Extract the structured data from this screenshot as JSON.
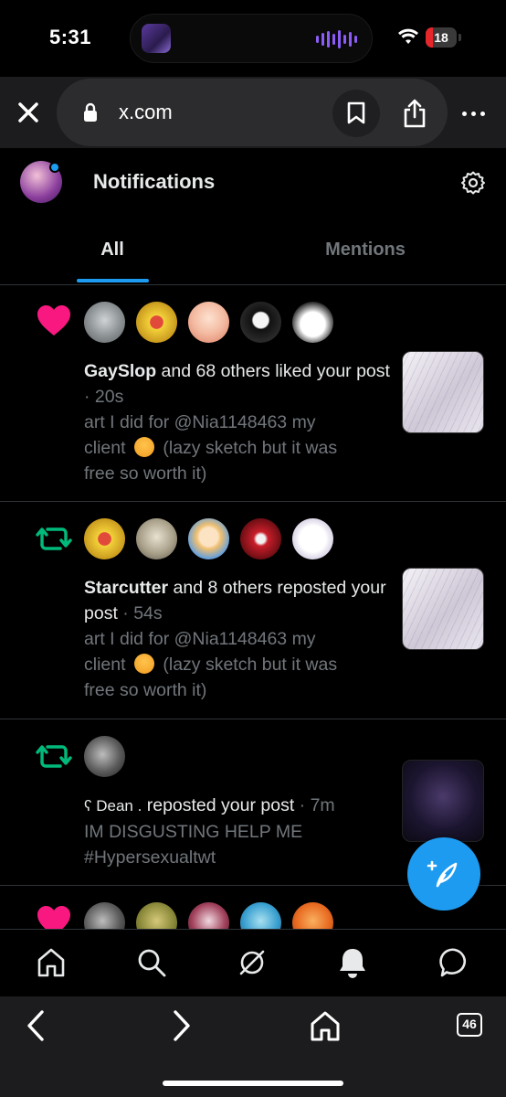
{
  "status_bar": {
    "time": "5:31",
    "battery": "18"
  },
  "browser": {
    "url": "x.com",
    "tab_count": "46"
  },
  "header": {
    "title": "Notifications"
  },
  "tabs": [
    {
      "label": "All"
    },
    {
      "label": "Mentions"
    }
  ],
  "notifications": [
    {
      "type": "like",
      "name": "GaySlop",
      "action": " and 68 others liked your post",
      "meta": " · 20s",
      "snippet_1": "art I did for @Nia1148463 my",
      "snippet_2": "client ",
      "snippet_3": " (lazy sketch but it was",
      "snippet_4": "free so worth it)"
    },
    {
      "type": "repost",
      "name": "Starcutter",
      "action": " and 8 others reposted your post",
      "meta": " · 54s",
      "snippet_1": "art I did for @Nia1148463 my",
      "snippet_2": "client ",
      "snippet_3": " (lazy sketch but it was",
      "snippet_4": "free so worth it)"
    },
    {
      "type": "repost",
      "name": "ʕ Dean .",
      "action": " reposted your post",
      "meta": " · 7m",
      "snippet_1": "IM DISGUSTING HELP ME",
      "snippet_2": "#Hypersexualtwt"
    }
  ],
  "colors": {
    "accent": "#1d9bf0",
    "like": "#f91880",
    "repost": "#00ba7c",
    "muted": "#71767b"
  },
  "icons": [
    "close-icon",
    "lock-icon",
    "bookmark-icon",
    "share-icon",
    "more-icon",
    "settings-icon",
    "heart-icon",
    "repost-icon",
    "compose-icon",
    "home-icon",
    "search-icon",
    "grok-icon",
    "bell-icon",
    "messages-icon",
    "back-icon",
    "forward-icon"
  ]
}
